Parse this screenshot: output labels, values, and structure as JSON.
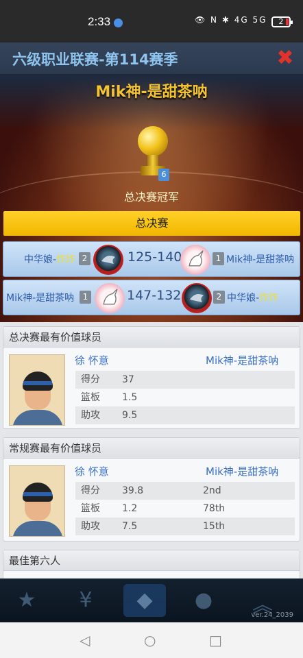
{
  "status_bar": {
    "time": "2:33",
    "icons": "👁 N ✱ 4G 5G",
    "battery": "2"
  },
  "title_bar": {
    "title": "六级职业联赛-第114赛季",
    "close_icon": "✖"
  },
  "hero": {
    "champion_name": "Mik神-是甜茶呐",
    "trophy_badge": "6",
    "champion_label": "总决赛冠军",
    "finals_label": "总决赛"
  },
  "games": [
    {
      "home_team": "中华娘-",
      "home_team_highlight": "炸炸",
      "home_seed": "2",
      "score": "125-140",
      "away_seed": "1",
      "away_team": "Mik神-是甜茶呐"
    },
    {
      "home_team": "Mik神-是甜茶呐",
      "home_seed": "1",
      "score": "147-132",
      "away_seed": "2",
      "away_team": "中华娘-",
      "away_team_highlight": "炸炸"
    }
  ],
  "finals_mvp": {
    "header": "总决赛最有价值球员",
    "player_name": "徐 怀意",
    "team": "Mik神-是甜茶呐",
    "stats": [
      {
        "label": "得分",
        "value": "37"
      },
      {
        "label": "篮板",
        "value": "1.5"
      },
      {
        "label": "助攻",
        "value": "9.5"
      }
    ]
  },
  "regular_mvp": {
    "header": "常规赛最有价值球员",
    "player_name": "徐 怀意",
    "team": "Mik神-是甜茶呐",
    "stats": [
      {
        "label": "得分",
        "value": "39.8",
        "rank": "2nd"
      },
      {
        "label": "篮板",
        "value": "1.2",
        "rank": "78th"
      },
      {
        "label": "助攻",
        "value": "7.5",
        "rank": "15th"
      }
    ]
  },
  "sixth_man": {
    "header": "最佳第六人"
  },
  "bottom_nav": {
    "version": "ver.24_2039"
  },
  "colors": {
    "accent_gold": "#f4c430",
    "link_blue": "#3a6fc8",
    "close_red": "#e0332b"
  }
}
